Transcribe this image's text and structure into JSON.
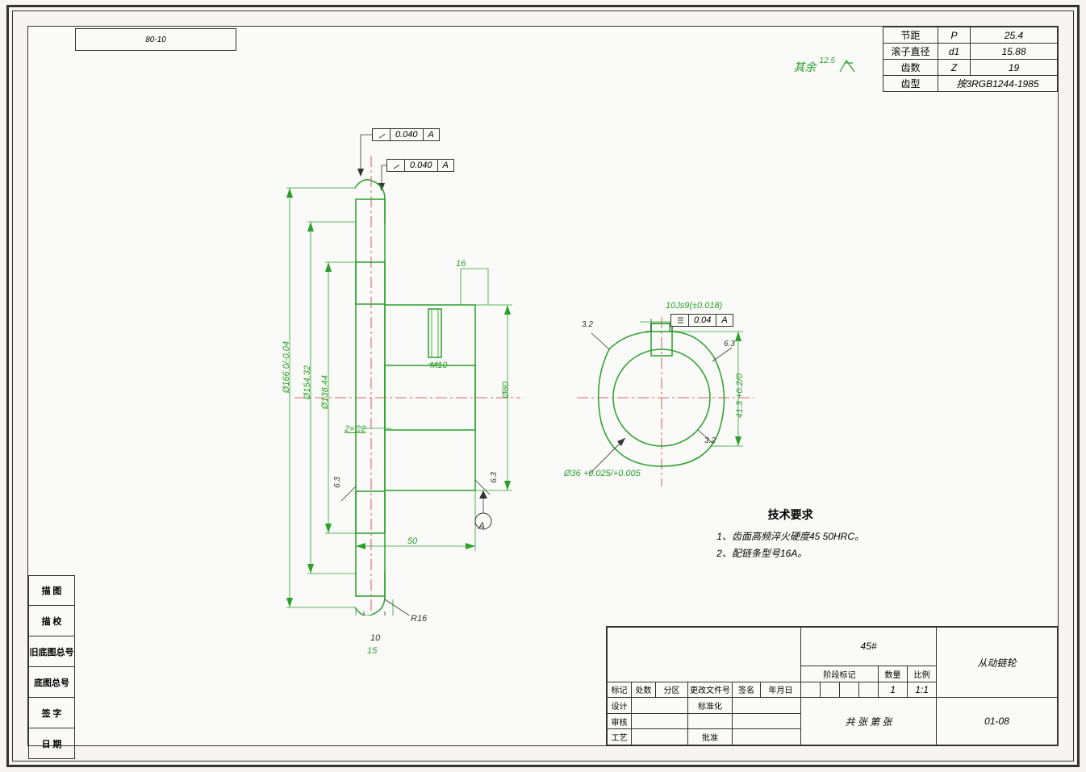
{
  "top_left_code": "80-10",
  "qy_label": "其余",
  "qy_value": "12.5",
  "param_table": {
    "rows": [
      {
        "label": "节距",
        "sym": "P",
        "val": "25.4"
      },
      {
        "label": "滚子直径",
        "sym": "d1",
        "val": "15.88"
      },
      {
        "label": "齿数",
        "sym": "Z",
        "val": "19"
      },
      {
        "label": "齿型",
        "sym": "",
        "val": "按3RGB1244-1985"
      }
    ]
  },
  "fcf1": {
    "symbol": "↗",
    "tol": "0.040",
    "datum": "A"
  },
  "fcf2": {
    "symbol": "↗",
    "tol": "0.040",
    "datum": "A"
  },
  "fcf3": {
    "symbol": "≡",
    "tol": "0.04",
    "datum": "A"
  },
  "key_tol": "10Js9(±0.018)",
  "dims": {
    "d166": "Ø166 0/-0.04",
    "d154": "Ø154.32",
    "d138": "Ø138.44",
    "d80": "Ø80",
    "d36": "Ø36 +0.025/+0.005",
    "w16": "16",
    "w50": "50",
    "w10": "10",
    "w15": "15",
    "m10": "M10",
    "chamfer": "2×C2",
    "r16": "R16",
    "surf63a": "6.3",
    "surf63b": "6.3",
    "surf32": "3.2",
    "surf32b": "3.2",
    "surf63c": "6.3",
    "h41": "41.3 +0.2/0"
  },
  "datum_a": "A",
  "tech_req": {
    "title": "技术要求",
    "l1": "1、齿面高频淬火硬度45 50HRC。",
    "l2": "2、配链条型号16A。"
  },
  "left_boxes": [
    "描 图",
    "描 校",
    "旧底图总号",
    "底图总号",
    "签 字",
    "日 期"
  ],
  "title_block": {
    "material": "45#",
    "part_name": "从动链轮",
    "drawing_no": "01-08",
    "qty": "1",
    "scale": "1:1",
    "headers": {
      "mark": "标记",
      "cnt": "处数",
      "zone": "分区",
      "doc": "更改文件号",
      "sig": "签名",
      "date": "年月日",
      "design": "设计",
      "std": "标准化",
      "check": "审核",
      "tech": "工艺",
      "approve": "批准",
      "stage": "阶段标记",
      "sheets": "数量",
      "scale_h": "比例",
      "org": "共 张 第 张"
    }
  }
}
